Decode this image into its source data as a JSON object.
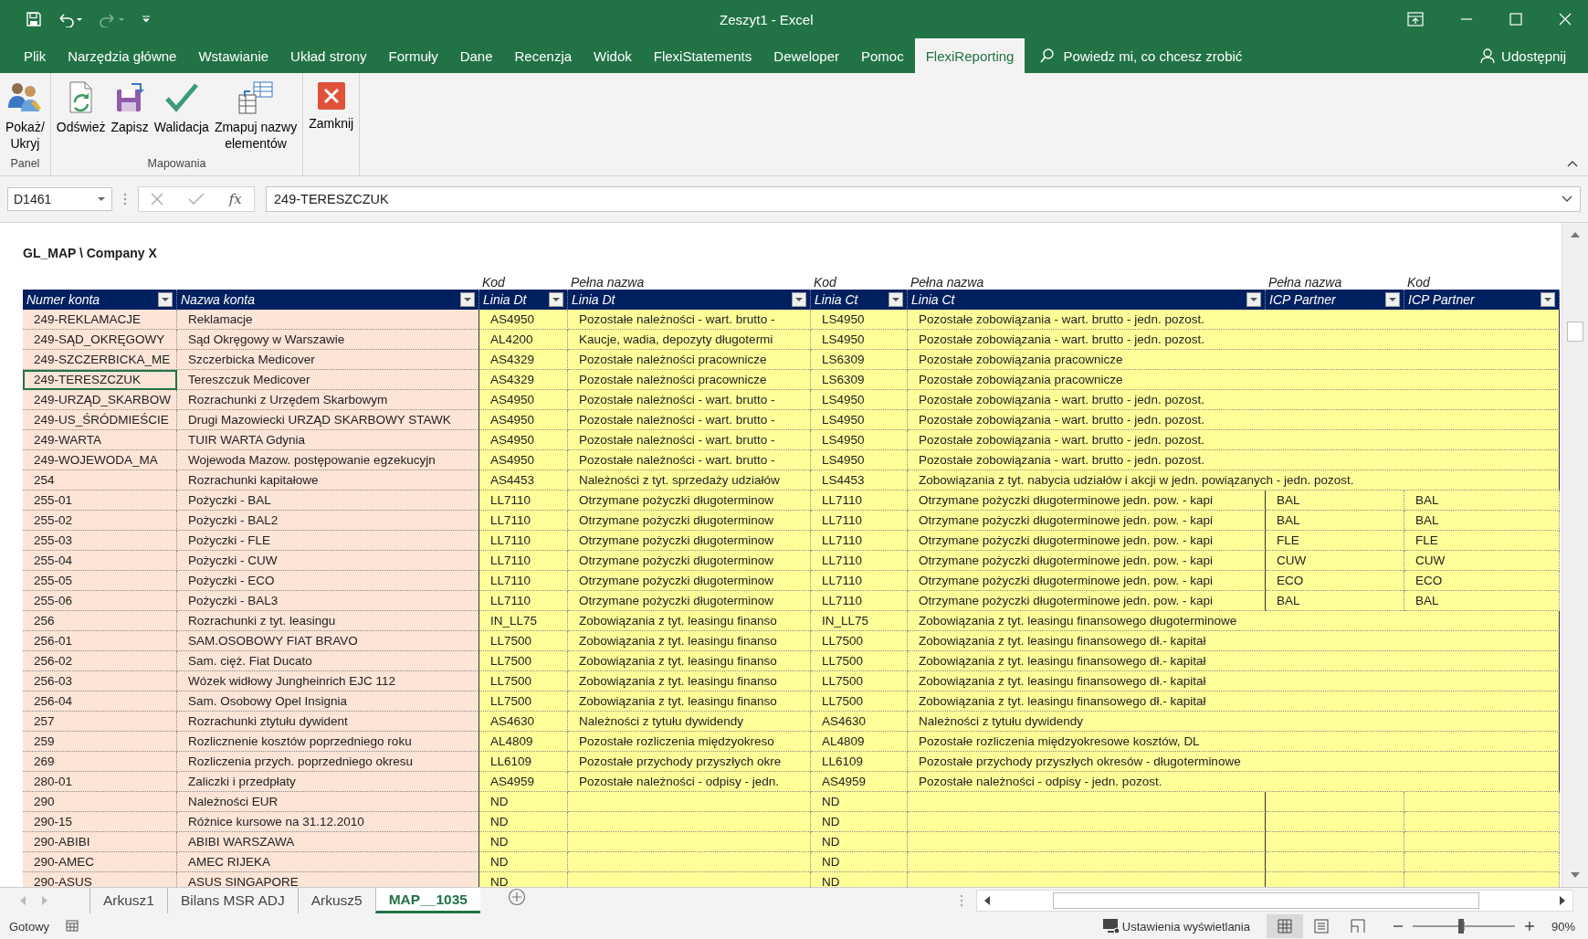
{
  "window": {
    "title": "Zeszyt1  -  Excel"
  },
  "ribbon_tabs": [
    {
      "label": "Plik",
      "selected": false
    },
    {
      "label": "Narzędzia główne",
      "selected": false
    },
    {
      "label": "Wstawianie",
      "selected": false
    },
    {
      "label": "Układ strony",
      "selected": false
    },
    {
      "label": "Formuły",
      "selected": false
    },
    {
      "label": "Dane",
      "selected": false
    },
    {
      "label": "Recenzja",
      "selected": false
    },
    {
      "label": "Widok",
      "selected": false
    },
    {
      "label": "FlexiStatements",
      "selected": false
    },
    {
      "label": "Deweloper",
      "selected": false
    },
    {
      "label": "Pomoc",
      "selected": false
    },
    {
      "label": "FlexiReporting",
      "selected": true
    }
  ],
  "tell_me": "Powiedz mi, co chcesz zrobić",
  "share": "Udostępnij",
  "ribbon_groups": [
    {
      "label": "Panel",
      "buttons": [
        "Pokaż/\nUkryj"
      ]
    },
    {
      "label": "Mapowania",
      "buttons": [
        "Odśwież",
        "Zapisz",
        "Walidacja",
        "Zmapuj nazwy\nelementów"
      ]
    },
    {
      "buttons": [
        "Zamknij"
      ]
    }
  ],
  "formula_bar": {
    "name_box": "D1461",
    "fx": "fx",
    "value": "249-TERESZCZUK"
  },
  "sheet": {
    "title": "GL_MAP \\ Company X",
    "columns": [
      {
        "label": "Numer konta",
        "color": "#fce4d6"
      },
      {
        "label": "Nazwa konta",
        "color": "#fce4d6"
      },
      {
        "group_label": "Kod",
        "label": "Linia Dt",
        "color": "#ffff99"
      },
      {
        "group_label": "Pełna nazwa",
        "label": "Linia Dt",
        "color": "#ffff99"
      },
      {
        "group_label": "Kod",
        "label": "Linia Ct",
        "color": "#ffff99"
      },
      {
        "group_label": "Pełna nazwa",
        "label": "Linia Ct",
        "color": "#ffff99",
        "spills": true
      },
      {
        "group_label": "Pełna nazwa",
        "label": "ICP Partner",
        "color": "#ffff99"
      },
      {
        "group_label": "Kod",
        "label": "ICP Partner",
        "color": "#ffff99"
      }
    ],
    "rows": [
      {
        "selected": false,
        "cells": [
          "249-REKLAMACJE",
          "Reklamacje",
          "AS4950",
          "Pozostałe należności - wart. brutto -",
          "LS4950",
          "Pozostałe zobowiązania - wart. brutto - jedn. pozost.",
          null,
          null
        ]
      },
      {
        "selected": false,
        "cells": [
          "249-SĄD_OKRĘGOWY",
          "Sąd Okręgowy w Warszawie",
          "AL4200",
          "Kaucje, wadia, depozyty długotermi",
          "LS4950",
          "Pozostałe zobowiązania - wart. brutto - jedn. pozost.",
          null,
          null
        ]
      },
      {
        "selected": false,
        "cells": [
          "249-SZCZERBICKA_ME",
          "Szczerbicka Medicover",
          "AS4329",
          "Pozostałe należności pracownicze",
          "LS6309",
          "Pozostałe zobowiązania pracownicze",
          null,
          null
        ]
      },
      {
        "selected": true,
        "cells": [
          "249-TERESZCZUK",
          "Tereszczuk Medicover",
          "AS4329",
          "Pozostałe należności pracownicze",
          "LS6309",
          "Pozostałe zobowiązania pracownicze",
          null,
          null
        ]
      },
      {
        "selected": false,
        "cells": [
          "249-URZĄD_SKARBOW",
          "Rozrachunki z Urzędem Skarbowym",
          "AS4950",
          "Pozostałe należności - wart. brutto -",
          "LS4950",
          "Pozostałe zobowiązania - wart. brutto - jedn. pozost.",
          null,
          null
        ]
      },
      {
        "selected": false,
        "cells": [
          "249-US_ŚRÓDMIEŚCIE",
          "Drugi Mazowiecki URZĄD SKARBOWY STAWK",
          "AS4950",
          "Pozostałe należności - wart. brutto -",
          "LS4950",
          "Pozostałe zobowiązania - wart. brutto - jedn. pozost.",
          null,
          null
        ]
      },
      {
        "selected": false,
        "cells": [
          "249-WARTA",
          "TUIR WARTA Gdynia",
          "AS4950",
          "Pozostałe należności - wart. brutto -",
          "LS4950",
          "Pozostałe zobowiązania - wart. brutto - jedn. pozost.",
          null,
          null
        ]
      },
      {
        "selected": false,
        "cells": [
          "249-WOJEWODA_MA",
          "Wojewoda Mazow. postępowanie egzekucyjn",
          "AS4950",
          "Pozostałe należności - wart. brutto -",
          "LS4950",
          "Pozostałe zobowiązania - wart. brutto - jedn. pozost.",
          null,
          null
        ]
      },
      {
        "selected": false,
        "cells": [
          "254",
          "Rozrachunki kapitałowe",
          "AS4453",
          "Należności z tyt. sprzedaży udziałów",
          "LS4453",
          "Zobowiązania z tyt. nabycia udziałów i akcji w jedn. powiązanych - jedn. pozost.",
          null,
          null
        ]
      },
      {
        "selected": false,
        "cells": [
          "255-01",
          "Pożyczki - BAL",
          "LL7110",
          "Otrzymane pożyczki długoterminow",
          "LL7110",
          "Otrzymane pożyczki długoterminowe jedn. pow. - kapi",
          "BAL",
          "BAL"
        ]
      },
      {
        "selected": false,
        "cells": [
          "255-02",
          "Pożyczki - BAL2",
          "LL7110",
          "Otrzymane pożyczki długoterminow",
          "LL7110",
          "Otrzymane pożyczki długoterminowe jedn. pow. - kapi",
          "BAL",
          "BAL"
        ]
      },
      {
        "selected": false,
        "cells": [
          "255-03",
          "Pożyczki - FLE",
          "LL7110",
          "Otrzymane pożyczki długoterminow",
          "LL7110",
          "Otrzymane pożyczki długoterminowe jedn. pow. - kapi",
          "FLE",
          "FLE"
        ]
      },
      {
        "selected": false,
        "cells": [
          "255-04",
          "Pożyczki - CUW",
          "LL7110",
          "Otrzymane pożyczki długoterminow",
          "LL7110",
          "Otrzymane pożyczki długoterminowe jedn. pow. - kapi",
          "CUW",
          "CUW"
        ]
      },
      {
        "selected": false,
        "cells": [
          "255-05",
          "Pożyczki - ECO",
          "LL7110",
          "Otrzymane pożyczki długoterminow",
          "LL7110",
          "Otrzymane pożyczki długoterminowe jedn. pow. - kapi",
          "ECO",
          "ECO"
        ]
      },
      {
        "selected": false,
        "cells": [
          "255-06",
          "Pożyczki - BAL3",
          "LL7110",
          "Otrzymane pożyczki długoterminow",
          "LL7110",
          "Otrzymane pożyczki długoterminowe jedn. pow. - kapi",
          "BAL",
          "BAL"
        ]
      },
      {
        "selected": false,
        "cells": [
          "256",
          "Rozrachunki z tyt. leasingu",
          "IN_LL75",
          "Zobowiązania z tyt. leasingu finanso",
          "IN_LL75",
          "Zobowiązania z tyt. leasingu finansowego długoterminowe",
          null,
          null
        ]
      },
      {
        "selected": false,
        "cells": [
          "256-01",
          "SAM.OSOBOWY FIAT BRAVO",
          "LL7500",
          "Zobowiązania z tyt. leasingu finanso",
          "LL7500",
          "Zobowiązania z tyt. leasingu finansowego dł.- kapitał",
          null,
          null
        ]
      },
      {
        "selected": false,
        "cells": [
          "256-02",
          "Sam. cięż. Fiat Ducato",
          "LL7500",
          "Zobowiązania z tyt. leasingu finanso",
          "LL7500",
          "Zobowiązania z tyt. leasingu finansowego dł.- kapitał",
          null,
          null
        ]
      },
      {
        "selected": false,
        "cells": [
          "256-03",
          "Wózek widłowy Jungheinrich EJC 112",
          "LL7500",
          "Zobowiązania z tyt. leasingu finanso",
          "LL7500",
          "Zobowiązania z tyt. leasingu finansowego dł.- kapitał",
          null,
          null
        ]
      },
      {
        "selected": false,
        "cells": [
          "256-04",
          "Sam. Osobowy Opel Insignia",
          "LL7500",
          "Zobowiązania z tyt. leasingu finanso",
          "LL7500",
          "Zobowiązania z tyt. leasingu finansowego dł.- kapitał",
          null,
          null
        ]
      },
      {
        "selected": false,
        "cells": [
          "257",
          "Rozrachunki  ztytułu dywident",
          "AS4630",
          "Należności z tytułu dywidendy",
          "AS4630",
          "Należności z tytułu dywidendy",
          null,
          null
        ]
      },
      {
        "selected": false,
        "cells": [
          "259",
          "Rozlicznenie kosztów poprzedniego roku",
          "AL4809",
          "Pozostałe rozliczenia międzyokreso",
          "AL4809",
          "Pozostałe rozliczenia międzyokresowe kosztów, DL",
          null,
          null
        ]
      },
      {
        "selected": false,
        "cells": [
          "269",
          "Rozliczenia przych. poprzedniego okresu",
          "LL6109",
          "Pozostałe przychody przyszłych okre",
          "LL6109",
          "Pozostałe przychody przyszłych okresów - długoterminowe",
          null,
          null
        ]
      },
      {
        "selected": false,
        "cells": [
          "280-01",
          "Zaliczki i przedpłaty",
          "AS4959",
          "Pozostałe należności - odpisy - jedn.",
          "AS4959",
          "Pozostałe należności - odpisy - jedn. pozost.",
          null,
          null
        ]
      },
      {
        "selected": false,
        "cells": [
          "290",
          "Należności EUR",
          "ND",
          null,
          "ND",
          null,
          null,
          null
        ]
      },
      {
        "selected": false,
        "cells": [
          "290-15",
          "Różnice kursowe na 31.12.2010",
          "ND",
          null,
          "ND",
          null,
          null,
          null
        ]
      },
      {
        "selected": false,
        "cells": [
          "290-ABIBI",
          "ABIBI WARSZAWA",
          "ND",
          null,
          "ND",
          null,
          null,
          null
        ]
      },
      {
        "selected": false,
        "cells": [
          "290-AMEC",
          "AMEC RIJEKA",
          "ND",
          null,
          "ND",
          null,
          null,
          null
        ]
      },
      {
        "selected": false,
        "cells": [
          "290-ASUS",
          "ASUS SINGAPORE",
          "ND",
          null,
          "ND",
          null,
          null,
          null
        ]
      }
    ]
  },
  "sheet_tabs": [
    {
      "label": "Arkusz1",
      "selected": false
    },
    {
      "label": "Bilans MSR ADJ",
      "selected": false
    },
    {
      "label": "Arkusz5",
      "selected": false
    },
    {
      "label": "MAP__1035",
      "selected": true
    }
  ],
  "status_bar": {
    "status": "Gotowy",
    "display_settings": "Ustawienia wyświetlania",
    "zoom": {
      "level": 0.47,
      "reading": "90%"
    }
  }
}
